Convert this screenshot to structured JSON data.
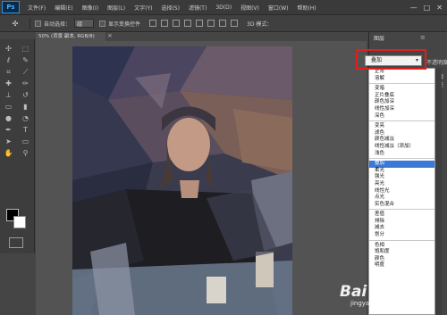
{
  "app": {
    "logo": "Ps",
    "menus": [
      "文件(F)",
      "编辑(E)",
      "图像(I)",
      "图层(L)",
      "文字(Y)",
      "选择(S)",
      "滤镜(T)",
      "3D(D)",
      "视图(V)",
      "窗口(W)",
      "帮助(H)"
    ],
    "window_controls": [
      "—",
      "□",
      "✕"
    ]
  },
  "options_bar": {
    "auto_select_label": "自动选择：",
    "auto_select_value": "组",
    "show_transform_label": "显示变换控件",
    "mode_3d_label": "3D 模式："
  },
  "document": {
    "tab_title": "50% (背景 副本, RGB/8)",
    "close_glyph": "×"
  },
  "layers_panel": {
    "tab_label": "图层",
    "blend_mode_current": "叠加",
    "opacity_label": "不透明度",
    "fill_label": "填充"
  },
  "blend_groups": [
    [
      "正常",
      "溶解"
    ],
    [
      "变暗",
      "正片叠底",
      "颜色加深",
      "线性加深",
      "深色"
    ],
    [
      "变亮",
      "滤色",
      "颜色减淡",
      "线性减淡（添加）",
      "浅色"
    ],
    [
      "叠加",
      "柔光",
      "强光",
      "亮光",
      "线性光",
      "点光",
      "实色混合"
    ],
    [
      "差值",
      "排除",
      "减去",
      "划分"
    ],
    [
      "色相",
      "饱和度",
      "颜色",
      "明度"
    ]
  ],
  "watermark": {
    "main": "Bai 经验",
    "sub": "jingyan.baidu.com"
  },
  "colors": {
    "selected_item": "#3b78d8",
    "highlight_box": "#e02020",
    "ps_blue": "#46b0ff"
  }
}
